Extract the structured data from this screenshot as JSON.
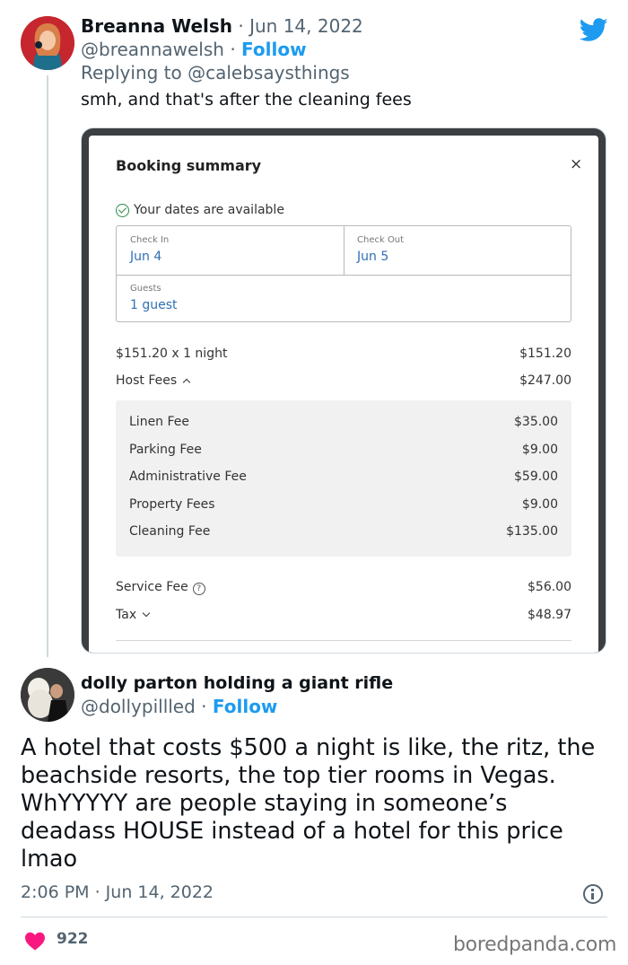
{
  "reply": {
    "name": "Breanna Welsh",
    "date": "Jun 14, 2022",
    "handle": "@breannawelsh",
    "follow_label": "Follow",
    "replying_prefix": "Replying to",
    "replying_to": "@calebsaysthings",
    "text": "smh, and that's after the cleaning fees"
  },
  "booking": {
    "title": "Booking summary",
    "close_symbol": "×",
    "availability": "Your dates are available",
    "check_in_label": "Check In",
    "check_in_value": "Jun 4",
    "check_out_label": "Check Out",
    "check_out_value": "Jun 5",
    "guests_label": "Guests",
    "guests_value": "1 guest",
    "nightly_label": "$151.20 x 1 night",
    "nightly_amount": "$151.20",
    "host_fees_label": "Host Fees",
    "host_fees_amount": "$247.00",
    "fees": [
      {
        "label": "Linen Fee",
        "amount": "$35.00"
      },
      {
        "label": "Parking Fee",
        "amount": "$9.00"
      },
      {
        "label": "Administrative Fee",
        "amount": "$59.00"
      },
      {
        "label": "Property Fees",
        "amount": "$9.00"
      },
      {
        "label": "Cleaning Fee",
        "amount": "$135.00"
      }
    ],
    "service_fee_label": "Service Fee",
    "service_fee_amount": "$56.00",
    "tax_label": "Tax",
    "tax_amount": "$48.97",
    "help_symbol": "?"
  },
  "original": {
    "name": "dolly parton holding a giant rifle",
    "handle": "@dollypillled",
    "follow_label": "Follow",
    "text": "A hotel that costs $500 a night is like, the ritz, the\nbeachside resorts, the top tier rooms in Vegas.\nWhYYYYY are people staying in someone’s\ndeadass HOUSE instead of a hotel for this price\nlmao",
    "time": "2:06 PM · Jun 14, 2022",
    "like_count": "922"
  },
  "watermark": "boredpanda.com",
  "colors": {
    "twitter_blue": "#1d9bf0",
    "like_red": "#f91880",
    "muted_text": "#536471"
  }
}
